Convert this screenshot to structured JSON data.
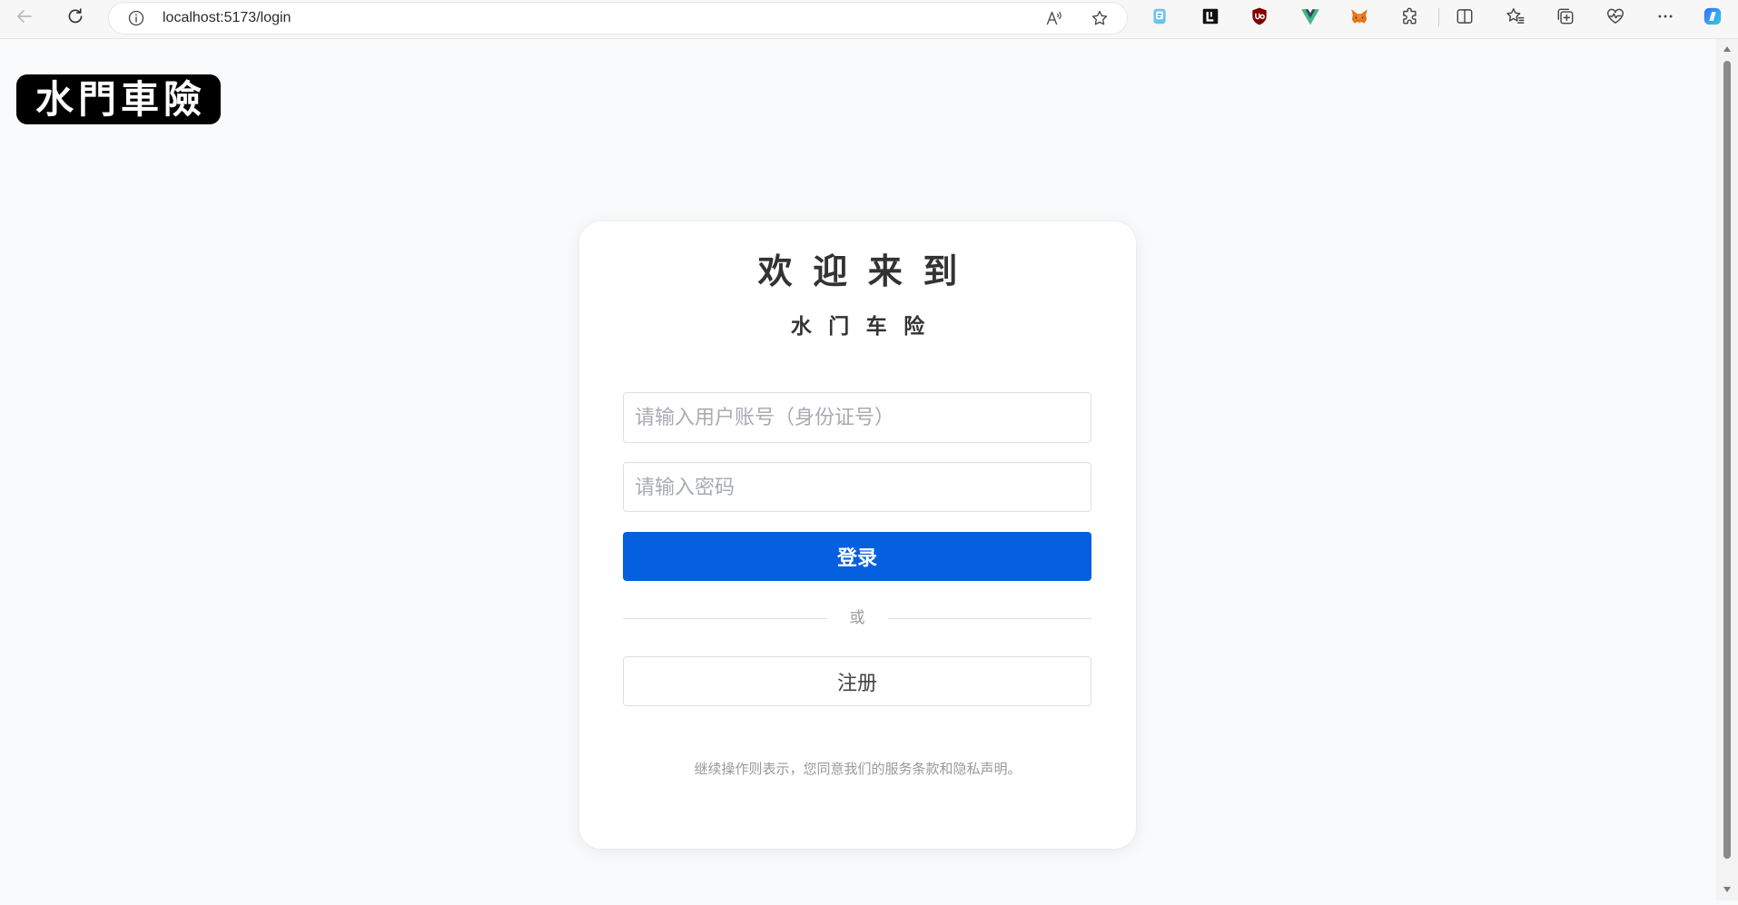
{
  "browser": {
    "url": "localhost:5173/login",
    "icons": {
      "back": "back-arrow-icon",
      "reload": "reload-icon",
      "site_info": "info-icon",
      "read_aloud": "read-aloud-icon",
      "add_favorite": "star-icon",
      "extensions": [
        "blue-extension-icon",
        "black-extension-icon",
        "ublock-origin-icon",
        "vue-devtools-icon",
        "metamask-icon",
        "extensions-puzzle-icon"
      ],
      "split_screen": "split-screen-icon",
      "favorites": "favorites-icon",
      "collections": "collections-icon",
      "browser_essentials": "heart-pulse-icon",
      "more": "more-dots-icon",
      "copilot": "copilot-icon"
    }
  },
  "logo": {
    "text": "水門車險"
  },
  "login_card": {
    "title": "欢 迎 来 到",
    "subtitle": "水 门 车 险",
    "username_placeholder": "请输入用户账号（身份证号）",
    "password_placeholder": "请输入密码",
    "login_button": "登录",
    "divider_text": "或",
    "register_button": "注册",
    "agreement_note": "继续操作则表示，您同意我们的服务条款和隐私声明。"
  },
  "colors": {
    "page_background": "#f9fafb",
    "card_background": "#ffffff",
    "accent": "#0560df",
    "logo_background": "#000000",
    "input_border": "#dcdfe6",
    "placeholder": "#a8abb2"
  }
}
